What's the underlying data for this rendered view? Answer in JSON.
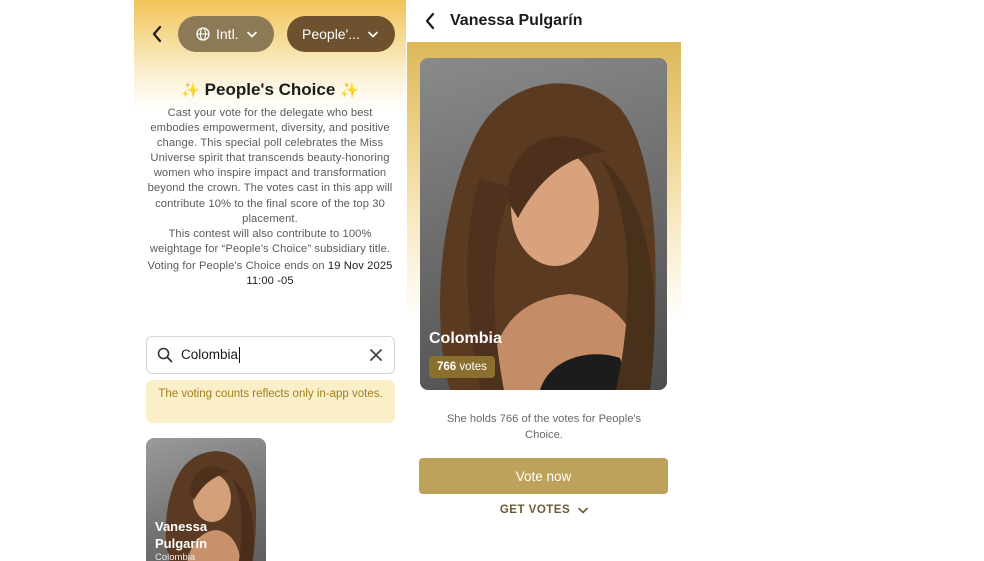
{
  "left": {
    "region_pill": {
      "label": "Intl."
    },
    "category_pill": {
      "label": "People'..."
    },
    "title": {
      "spark_left": "✨",
      "text": "People's Choice",
      "spark_right": "✨"
    },
    "description": {
      "p1": "Cast your vote for the delegate who best embodies empowerment, diversity, and positive change. This special poll celebrates the Miss Universe spirit that transcends beauty-honoring women who inspire impact and transformation beyond the crown. The votes cast in this app will contribute 10% to the final score of the top 30 placement.",
      "p2": "This contest will also contribute to 100% weightage for “People's Choice” subsidiary title.",
      "p3_prefix": "Voting for People's Choice ends on ",
      "p3_date": "19 Nov 2025 11:00 -05"
    },
    "search": {
      "value": "Colombia"
    },
    "notice": "The voting counts reflects only in-app votes.",
    "card": {
      "name": "Vanessa Pulgarín",
      "country": "Colombia"
    }
  },
  "right": {
    "header_title": "Vanessa Pulgarín",
    "photo": {
      "country": "Colombia",
      "votes_count": "766",
      "votes_suffix": " votes"
    },
    "holds_text": "She holds 766 of the votes for People's Choice.",
    "vote_button": "Vote now",
    "get_votes": "GET VOTES"
  },
  "colors": {
    "gold_accent": "#bea15a",
    "pill_intl": "#8b7a55",
    "pill_category": "#6e5230",
    "notice_bg": "#fbefc9",
    "notice_text": "#a0801f",
    "votes_badge": "#8a6f2e"
  },
  "icons": {
    "back": "chevron-left-icon",
    "globe": "globe-icon",
    "dropdown": "chevron-down-icon",
    "search": "search-icon",
    "clear": "close-icon"
  }
}
